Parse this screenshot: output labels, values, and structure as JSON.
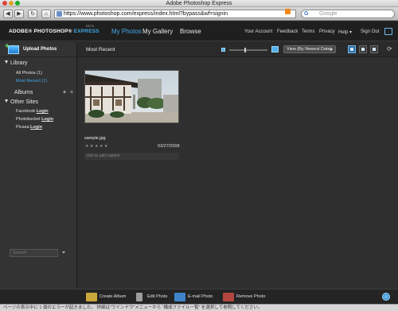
{
  "window": {
    "title": "Adobe Photoshop Express"
  },
  "browser": {
    "back_icon": "back-arrow-icon",
    "forward_icon": "forward-arrow-icon",
    "reload_icon": "reload-icon",
    "home_icon": "home-icon",
    "url": "https://www.photoshop.com/express/index.html?bypass&wf=signin",
    "search_placeholder": "Google",
    "search_engine_glyph": "G"
  },
  "app": {
    "brand_main": "ADOBE® PHOTOSHOP® ",
    "brand_express": "EXPRESS",
    "beta": "BETA",
    "tabs": [
      {
        "label": "My Photos",
        "active": true
      },
      {
        "label": "My Gallery",
        "active": false
      },
      {
        "label": "Browse",
        "active": false
      }
    ],
    "header_links": [
      "Your Account",
      "Feedback",
      "Terms",
      "Privacy",
      "Help ▾",
      "Sign Out"
    ]
  },
  "sidebar": {
    "upload_label": "Upload Photos",
    "library": {
      "title": "Library",
      "items": [
        {
          "label": "All Photos (1)",
          "active": false
        },
        {
          "label": "Most Recent (1)",
          "active": true
        }
      ]
    },
    "albums": {
      "title": "Albums",
      "add_glyph": "+",
      "remove_glyph": "×"
    },
    "other_sites": {
      "title": "Other Sites",
      "items": [
        {
          "site": "Facebook ",
          "link": "Login"
        },
        {
          "site": "Photobucket ",
          "link": "Login"
        },
        {
          "site": "Picasa ",
          "link": "Login"
        }
      ]
    },
    "search_placeholder": "Search"
  },
  "main": {
    "title": "Most Recent",
    "view_select": "View (By Newest Date)",
    "refresh_glyph": "⟳",
    "photo": {
      "filename": "sample.jpg",
      "date": "03/27/2008",
      "rating_glyphs": "★★★★★",
      "caption_placeholder": "click to add caption"
    }
  },
  "actions": [
    {
      "label": "Create Album",
      "icon": "create-album-icon",
      "color": "#c9a53a"
    },
    {
      "label": "Edit Photo",
      "icon": "edit-photo-icon",
      "color": "#9c9c9c"
    },
    {
      "label": "E-mail Photo",
      "icon": "email-photo-icon",
      "color": "#3f83c9"
    },
    {
      "label": "Remove Photo",
      "icon": "remove-photo-icon",
      "color": "#b3463f"
    }
  ],
  "status": {
    "text": "ページの表示中に 1 個のエラーが起きました。 詳細は“ウインドウ”メニューから “構成ファイル一覧” を選択して参照してください。"
  },
  "colors": {
    "accent": "#44a8e8",
    "background": "#2f2f2f"
  }
}
